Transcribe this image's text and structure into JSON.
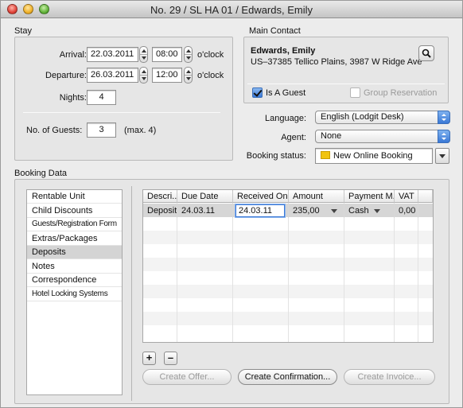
{
  "window": {
    "title": "No. 29 / SL HA 01 / Edwards, Emily"
  },
  "stay": {
    "group_label": "Stay",
    "arrival_label": "Arrival:",
    "arrival_date": "22.03.2011",
    "arrival_time": "08:00",
    "departure_label": "Departure:",
    "departure_date": "26.03.2011",
    "departure_time": "12:00",
    "oclock": "o'clock",
    "nights_label": "Nights:",
    "nights_value": "4",
    "guests_label": "No. of Guests:",
    "guests_value": "3",
    "guests_max": "(max. 4)"
  },
  "contact": {
    "group_label": "Main Contact",
    "name": "Edwards, Emily",
    "address": "US–37385 Tellico Plains, 3987 W Ridge Ave",
    "is_guest_label": "Is A Guest",
    "is_guest_checked": true,
    "group_res_label": "Group Reservation",
    "group_res_checked": false
  },
  "options": {
    "language_label": "Language:",
    "language_value": "English (Lodgit Desk)",
    "agent_label": "Agent:",
    "agent_value": "None",
    "status_label": "Booking status:",
    "status_value": "New Online Booking",
    "status_color": "#f1c40f"
  },
  "booking": {
    "group_label": "Booking Data",
    "nav": [
      {
        "label": "Rentable Unit",
        "selected": false
      },
      {
        "label": "Child Discounts",
        "selected": false
      },
      {
        "label": "Guests/Registration Form",
        "selected": false
      },
      {
        "label": "Extras/Packages",
        "selected": false
      },
      {
        "label": "Deposits",
        "selected": true
      },
      {
        "label": "Notes",
        "selected": false
      },
      {
        "label": "Correspondence",
        "selected": false
      },
      {
        "label": "Hotel Locking Systems",
        "selected": false
      }
    ],
    "columns": [
      "Descri...",
      "Due Date",
      "Received On",
      "Amount",
      "Payment M...",
      "VAT"
    ],
    "rows": [
      {
        "description": "Deposit",
        "due_date": "24.03.11",
        "received_on": "24.03.11",
        "amount": "235,00",
        "payment": "Cash",
        "vat": "0,00"
      }
    ],
    "add_label": "+",
    "remove_label": "–",
    "create_offer": "Create Offer...",
    "create_confirmation": "Create Confirmation...",
    "create_invoice": "Create Invoice..."
  }
}
